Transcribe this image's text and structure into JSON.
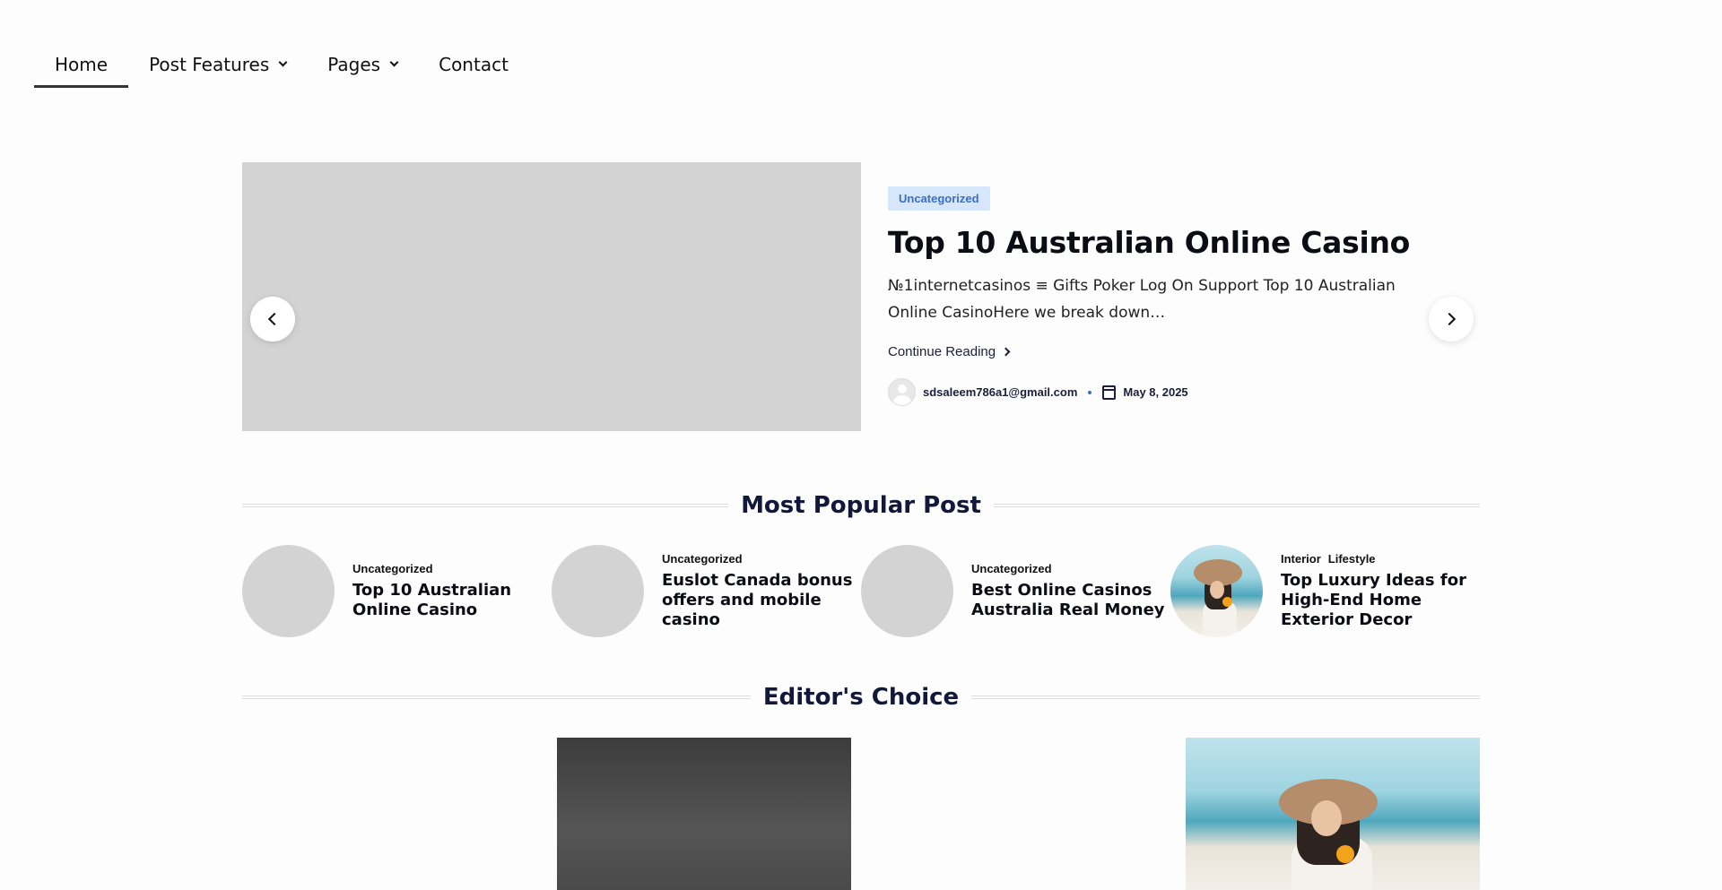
{
  "nav": {
    "items": [
      {
        "label": "Home",
        "active": true,
        "has_dropdown": false
      },
      {
        "label": "Post Features",
        "active": false,
        "has_dropdown": true
      },
      {
        "label": "Pages",
        "active": false,
        "has_dropdown": true
      },
      {
        "label": "Contact",
        "active": false,
        "has_dropdown": false
      }
    ]
  },
  "hero": {
    "category": "Uncategorized",
    "title": "Top 10 Australian Online Casino",
    "excerpt": "№1internetcasinos ≡ Gifts Poker Log On Support Top 10 Australian Online CasinoHere we break down…",
    "read_more": "Continue Reading",
    "author": "sdsaleem786a1@gmail.com",
    "date": "May 8, 2025",
    "prev_icon": "chevron-left-icon",
    "next_icon": "chevron-right-icon"
  },
  "popular": {
    "heading": "Most Popular Post",
    "items": [
      {
        "categories": [
          "Uncategorized"
        ],
        "title": "Top 10 Australian Online Casino"
      },
      {
        "categories": [
          "Uncategorized"
        ],
        "title": "Euslot Canada bonus offers and mobile casino"
      },
      {
        "categories": [
          "Uncategorized"
        ],
        "title": "Best Online Casinos Australia Real Money"
      },
      {
        "categories": [
          "Interior",
          "Lifestyle"
        ],
        "title": "Top Luxury Ideas for High-End Home Exterior Decor"
      }
    ]
  },
  "editors": {
    "heading": "Editor's Choice"
  },
  "colors": {
    "badge_bg": "#d6e6fb",
    "badge_text": "#3a6fc4",
    "heading": "#12183a",
    "placeholder": "#d3d3d3"
  }
}
